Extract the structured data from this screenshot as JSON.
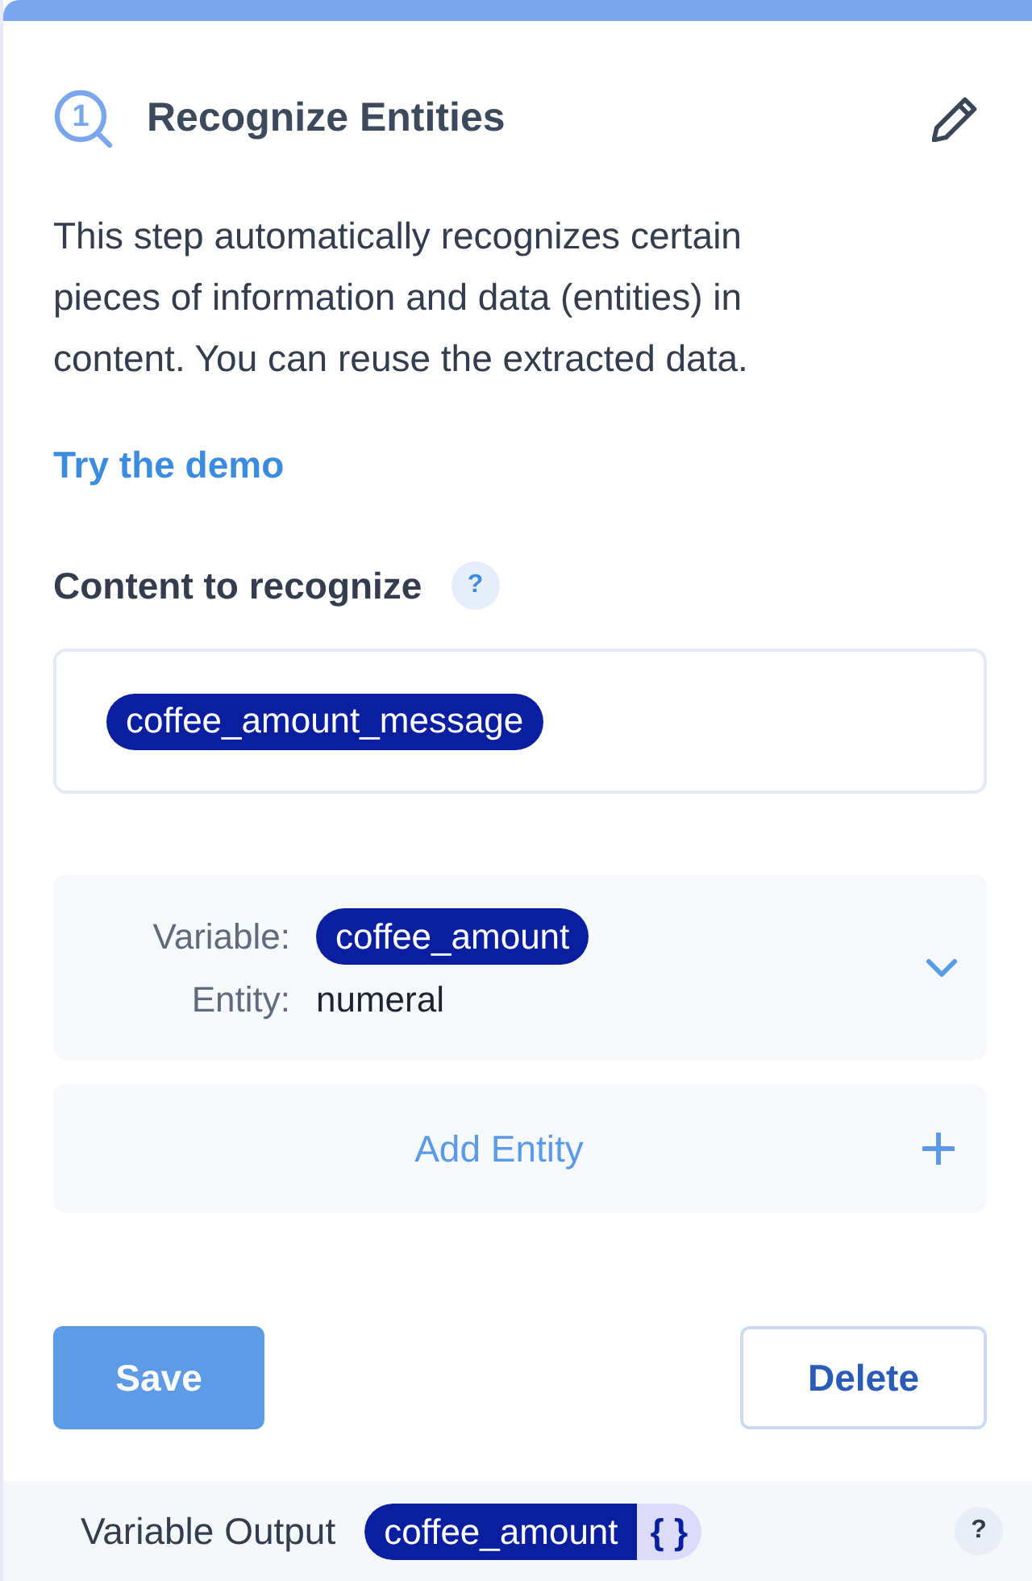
{
  "step": {
    "number": "1",
    "title": "Recognize Entities"
  },
  "description": "This step automatically recognizes certain pieces of information and data (entities) in content. You can reuse the extracted data.",
  "demo_link": "Try the demo",
  "content_field": {
    "label": "Content to recognize",
    "help": "?",
    "tokens": [
      "coffee_amount_message"
    ]
  },
  "entities": [
    {
      "variable_label": "Variable:",
      "variable": "coffee_amount",
      "entity_label": "Entity:",
      "entity": "numeral",
      "expanded": false
    }
  ],
  "add_entity": {
    "label": "Add Entity"
  },
  "buttons": [
    {
      "kind": "primary",
      "label": "Save"
    },
    {
      "kind": "secondary",
      "label": "Delete"
    }
  ],
  "output": {
    "label": "Variable Output",
    "variable": "coffee_amount",
    "braces": "{ }",
    "help": "?"
  }
}
